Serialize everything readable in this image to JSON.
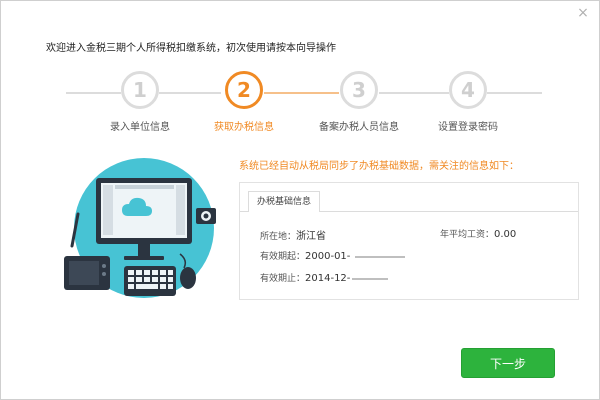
{
  "header": {
    "title": "欢迎进入金税三期个人所得税扣缴系统，初次使用请按本向导操作",
    "close_icon": "×"
  },
  "stepper": {
    "steps": [
      {
        "number": "1",
        "label": "录入单位信息"
      },
      {
        "number": "2",
        "label": "获取办税信息"
      },
      {
        "number": "3",
        "label": "备案办税人员信息"
      },
      {
        "number": "4",
        "label": "设置登录密码"
      }
    ],
    "active_index": 2
  },
  "notice": "系统已经自动从税局同步了办税基础数据，需关注的信息如下：",
  "info": {
    "tab_label": "办税基础信息",
    "location_label": "所在地：",
    "location_value": "浙江省",
    "avg_salary_label": "年平均工资：",
    "avg_salary_value": "0.00",
    "valid_from_label": "有效期起：",
    "valid_from_value": "2000-01-",
    "valid_to_label": "有效期止：",
    "valid_to_value": "2014-12-"
  },
  "buttons": {
    "next_label": "下一步"
  },
  "colors": {
    "accent_orange": "#f08a24",
    "green_button": "#2db33d",
    "inactive_gray": "#dcdcdc",
    "illustration_teal": "#47c3d4"
  }
}
